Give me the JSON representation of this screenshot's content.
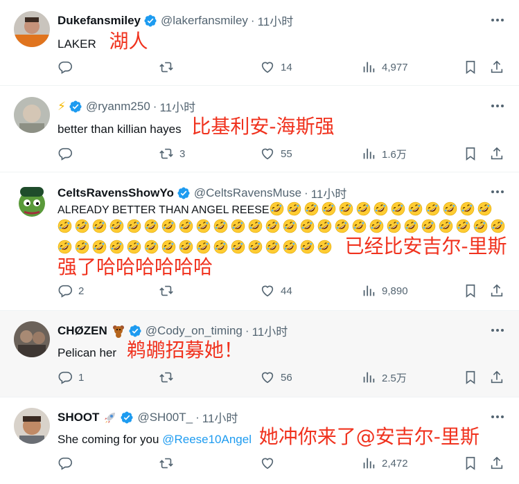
{
  "time_unit": "11小时",
  "tweets": [
    {
      "name": "Dukefansmiley",
      "handle": "@lakerfansmiley",
      "text": "LAKER",
      "annotation": "湖人",
      "replies": "",
      "reposts": "",
      "likes": "14",
      "views": "4,977"
    },
    {
      "name": "⚡",
      "handle": "@ryanm250",
      "text": "better than killian hayes",
      "annotation": "比基利安-海斯强",
      "replies": "",
      "reposts": "3",
      "likes": "55",
      "views": "1.6万"
    },
    {
      "name": "CeltsRavensShowYo",
      "handle": "@CeltsRavensMuse",
      "text": "ALREADY BETTER THAN ANGEL REESE",
      "emoji": "rolling-on-floor-laughing",
      "emoji_count": 55,
      "annotation": "已经比安吉尔-里斯强了哈哈哈哈哈哈",
      "replies": "2",
      "reposts": "",
      "likes": "44",
      "views": "9,890"
    },
    {
      "name": "CHØZEN",
      "name_emoji": "teddy-bear",
      "handle": "@Cody_on_timing",
      "text": "Pelican her",
      "annotation": "鹈鹕招募她！",
      "replies": "1",
      "reposts": "",
      "likes": "56",
      "views": "2.5万"
    },
    {
      "name": "SHOOT",
      "name_emoji": "rocket",
      "handle": "@SH00T_",
      "text": "She coming for you",
      "mention": "@Reese10Angel",
      "annotation": "她冲你来了@安吉尔-里斯",
      "replies": "",
      "reposts": "",
      "likes": "",
      "views": "2,472"
    }
  ],
  "colors": {
    "verified": "#1d9bf0",
    "annotation": "#f0321e",
    "meta": "#536471"
  }
}
